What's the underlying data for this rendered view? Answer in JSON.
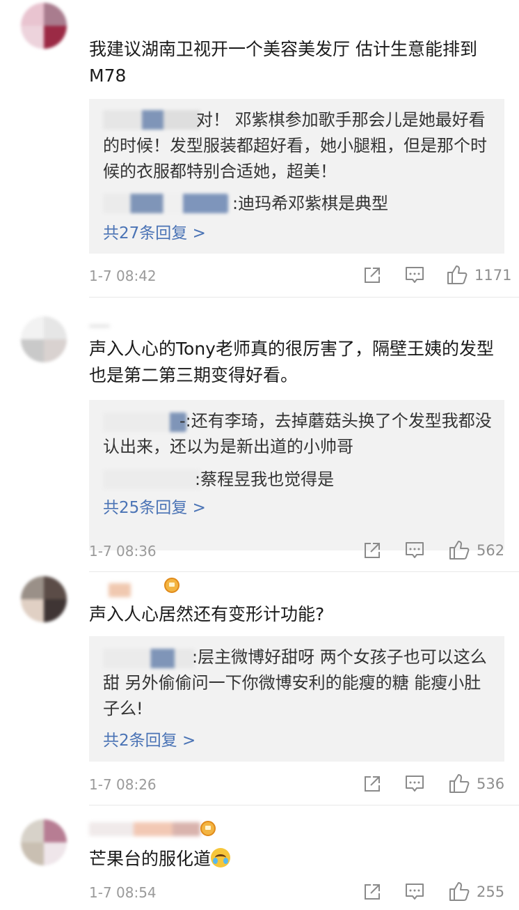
{
  "comments": [
    {
      "text": "我建议湖南卫视开一个美容美发厅 估计生意能排到M78",
      "replies": [
        {
          "text": "对！ 邓紫棋参加歌手那会儿是她最好看的时候！发型服装都超好看，她小腿粗，但是那个时候的衣服都特别合适她，超美！"
        },
        {
          "text": ":迪玛希邓紫棋是典型"
        }
      ],
      "more": "共27条回复 >",
      "time": "1-7 08:42",
      "likes": "1171"
    },
    {
      "text": "声入人心的Tony老师真的很厉害了，隔壁王姨的发型也是第二第三期变得好看。",
      "replies": [
        {
          "text": "-:还有李琦，去掉蘑菇头换了个发型我都没认出来，还以为是新出道的小帅哥"
        },
        {
          "text": ":蔡程昱我也觉得是"
        }
      ],
      "more": "共25条回复 >",
      "time": "1-7 08:36",
      "likes": "562"
    },
    {
      "text": "声入人心居然还有变形计功能?",
      "replies": [
        {
          "text": ":层主微博好甜呀 两个女孩子也可以这么甜 另外偷偷问一下你微博安利的能瘦的糖 能瘦小肚子么!"
        }
      ],
      "more": "共2条回复 >",
      "time": "1-7 08:26",
      "likes": "536"
    },
    {
      "text": "芒果台的服化道",
      "time": "1-7 08:54",
      "likes": "255"
    }
  ],
  "icons": {
    "repost": "share-icon",
    "comment": "comment-icon",
    "like": "thumbs-up-icon",
    "emoji": "laughing-crying-emoji-icon",
    "badge": "crown-badge-icon"
  },
  "colors": {
    "link": "#4a73b5",
    "reply_bg": "#f2f2f2",
    "meta": "#9a9a9a"
  }
}
